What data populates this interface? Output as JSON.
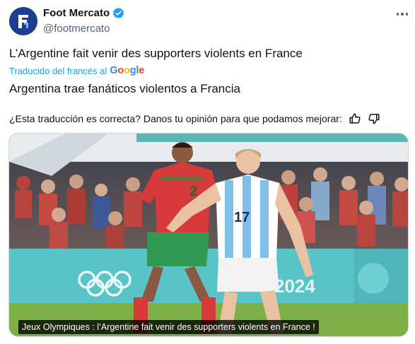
{
  "account": {
    "display_name": "Foot Mercato",
    "handle": "@footmercato",
    "avatar_icon": "foot-mercato-logo-icon",
    "verified_icon": "verified-badge-icon",
    "brand_color": "#1d3f8f"
  },
  "menu_icon": "more-options-icon",
  "tweet": {
    "original_text": "L’Argentine fait venir des supporters violents en France",
    "translated_label": "Traducido del francés al",
    "translator": "Google",
    "translated_text": "Argentina trae fanáticos violentos a Francia"
  },
  "feedback": {
    "question": "¿Esta traducción es correcta? Danos tu opinión para que podamos mejorar:",
    "thumbs_up_icon": "thumbs-up-icon",
    "thumbs_down_icon": "thumbs-down-icon"
  },
  "media": {
    "caption": "Jeux Olympiques : l’Argentine fait venir des supporters violents en France !",
    "player_left_number": "2",
    "player_right_number": "17",
    "board_text": "2024"
  },
  "colors": {
    "link_blue": "#1d9bf0",
    "secondary_text": "#536471",
    "google_blue": "#4285f4",
    "google_red": "#ea4335",
    "google_yellow": "#fbbc05",
    "google_green": "#34a853"
  }
}
